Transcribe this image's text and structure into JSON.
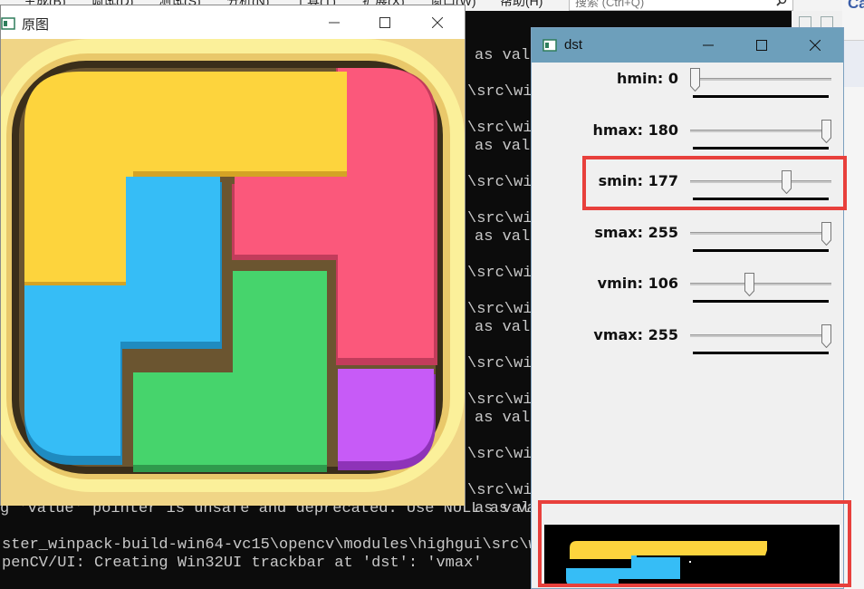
{
  "ide": {
    "menu_items": [
      "生成(B)",
      "调试(D)",
      "测试(S)",
      "分析(N)",
      "工具(T)",
      "扩展(X)",
      "窗口(W)",
      "帮助(H)"
    ],
    "search_placeholder": "搜索 (Ctrl+Q)",
    "right_letter": "Ca"
  },
  "console": {
    "right_lines": [
      "as val",
      "\\src\\wi",
      "\\src\\wi",
      "as val",
      "\\src\\wi",
      "\\src\\wi",
      "as val",
      "\\src\\wi",
      "\\src\\wi",
      "as val",
      "\\src\\wi",
      "\\src\\wi",
      "as val",
      "\\src\\wi",
      "\\src\\wi",
      "as val"
    ],
    "bottom_lines": [
      "g 'value' pointer is unsafe and deprecated. Use NULL as val",
      "ster_winpack-build-win64-vc15\\opencv\\modules\\highgui\\src\\wi",
      "penCV/UI: Creating Win32UI trackbar at 'dst': 'vmax'"
    ]
  },
  "image_window": {
    "title": "原图",
    "minimize_label": "—",
    "maximize_label": "☐",
    "close_label": "✕"
  },
  "dst_window": {
    "title": "dst",
    "trackbars": [
      {
        "label": "hmin: 0",
        "value": 0,
        "max": 180
      },
      {
        "label": "hmax: 180",
        "value": 180,
        "max": 180
      },
      {
        "label": "smin: 177",
        "value": 177,
        "max": 255
      },
      {
        "label": "smax: 255",
        "value": 255,
        "max": 255
      },
      {
        "label": "vmin: 106",
        "value": 106,
        "max": 255
      },
      {
        "label": "vmax: 255",
        "value": 255,
        "max": 255
      }
    ]
  },
  "colors": {
    "yellow": "#fdd43d",
    "blue": "#36bdf6",
    "pink": "#fb587b",
    "green": "#46d46c",
    "purple": "#c75bf7",
    "frame": "#f7e98e",
    "highlight": "#e8403c",
    "dst_titlebar": "#6d9fbb"
  }
}
